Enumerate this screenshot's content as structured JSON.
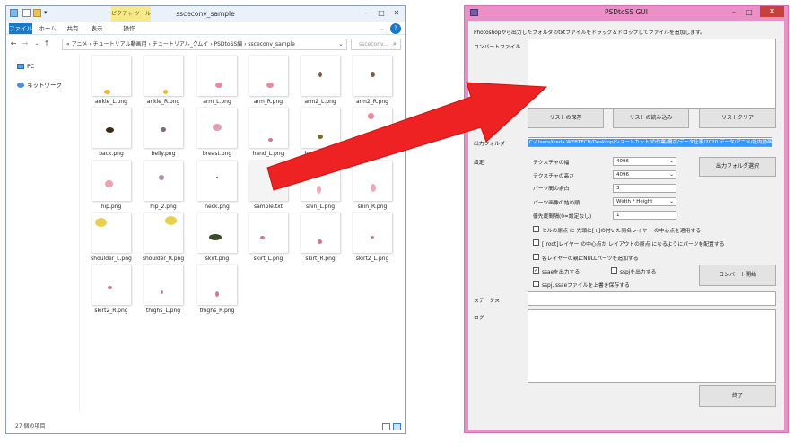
{
  "explorer": {
    "title": "ssceconv_sample",
    "context_tab": "ピクチャ ツール",
    "tabs": [
      "ファイル",
      "ホーム",
      "共有",
      "表示",
      "操作"
    ],
    "address": "« アニメ › チュートリアル動画用 › チュートリアル_クムイ › PSDtoSS編 › ssceconv_sample",
    "search_placeholder": "ssceconv...",
    "nav_items": [
      "PC",
      "ネットワーク"
    ],
    "files": [
      {
        "name": "ankle_L.png"
      },
      {
        "name": "ankle_R.png"
      },
      {
        "name": "arm_L.png"
      },
      {
        "name": "arm_R.png"
      },
      {
        "name": "arm2_L.png"
      },
      {
        "name": "arm2_R.png"
      },
      {
        "name": "back.png"
      },
      {
        "name": "belly.png"
      },
      {
        "name": "breast.png"
      },
      {
        "name": "hand_L.png"
      },
      {
        "name": "hand_R.png"
      },
      {
        "name": "head.png"
      },
      {
        "name": "hip.png"
      },
      {
        "name": "hip_2.png"
      },
      {
        "name": "neck.png"
      },
      {
        "name": "sample.txt"
      },
      {
        "name": "shin_L.png"
      },
      {
        "name": "shin_R.png"
      },
      {
        "name": "shoulder_L.png"
      },
      {
        "name": "shoulder_R.png"
      },
      {
        "name": "skirt.png"
      },
      {
        "name": "skirt_L.png"
      },
      {
        "name": "skirt_R.png"
      },
      {
        "name": "skirt2_L.png"
      },
      {
        "name": "skirt2_R.png"
      },
      {
        "name": "thighs_L.png"
      },
      {
        "name": "thighs_R.png"
      }
    ],
    "status": "27 個の項目"
  },
  "gui": {
    "title": "PSDtoSS GUI",
    "instruction": "Photoshopから出力したフォルダのtxtファイルをドラッグ＆ドロップしてファイルを追加します。",
    "convert_file_label": "コンバートファイル",
    "save_list": "リストの保存",
    "load_list": "リストの読み込み",
    "clear_list": "リストクリア",
    "output_folder_label": "出力フォルダ",
    "output_folder_value": "C:/Users/ikeda.WEBTECH/Desktop/ショートカット/の作業/構ポ/データ仕事/2020 データ/アニメ/社内動画",
    "settings_label": "設定",
    "texture_width_label": "テクスチャの幅",
    "texture_width_value": "4096",
    "texture_height_label": "テクスチャの高さ",
    "texture_height_value": "4096",
    "parts_margin_label": "パーツ間の余白",
    "parts_margin_value": "3",
    "packing_label": "パーツ画像の詰め順",
    "packing_value": "Width * Height",
    "priority_label": "優先度間隔(0=設定なし)",
    "priority_value": "1",
    "output_folder_btn": "出力フォルダ選択",
    "check1": "セルの原点 に 先頭に[+]の付いた同名レイヤー の中心点を適用する",
    "check2": "[!root]レイヤー の中心点が レイアウトの原点 になるようにパーツを配置する",
    "check3": "各レイヤーの親にNULLパーツを追加する",
    "check4": "ssaeを出力する",
    "check5": "sspjを出力する",
    "check6": "sspj, ssaeファイルを上書き保存する",
    "convert_btn": "コンバート開始",
    "status_label": "ステータス",
    "log_label": "ログ",
    "exit_btn": "終了"
  },
  "colors": {
    "gui_frame": "#eb8fc7",
    "arrow": "#ee2222",
    "selection": "#3399ff",
    "ribbon_file_tab": "#1979ca",
    "context_tab": "#f6e98a"
  }
}
